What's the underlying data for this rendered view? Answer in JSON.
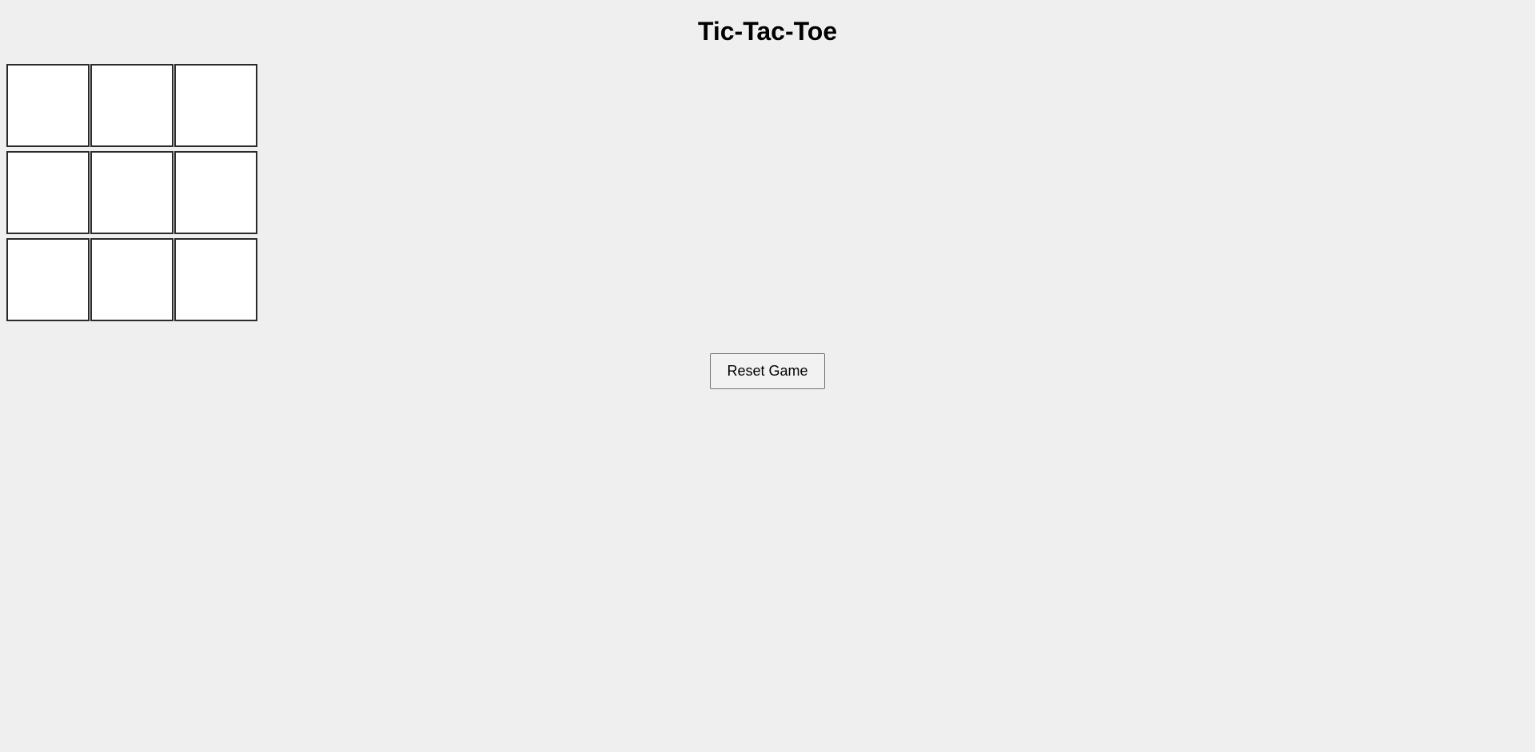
{
  "header": {
    "title": "Tic-Tac-Toe"
  },
  "board": {
    "cells": [
      "",
      "",
      "",
      "",
      "",
      "",
      "",
      "",
      ""
    ]
  },
  "controls": {
    "reset_label": "Reset Game"
  }
}
